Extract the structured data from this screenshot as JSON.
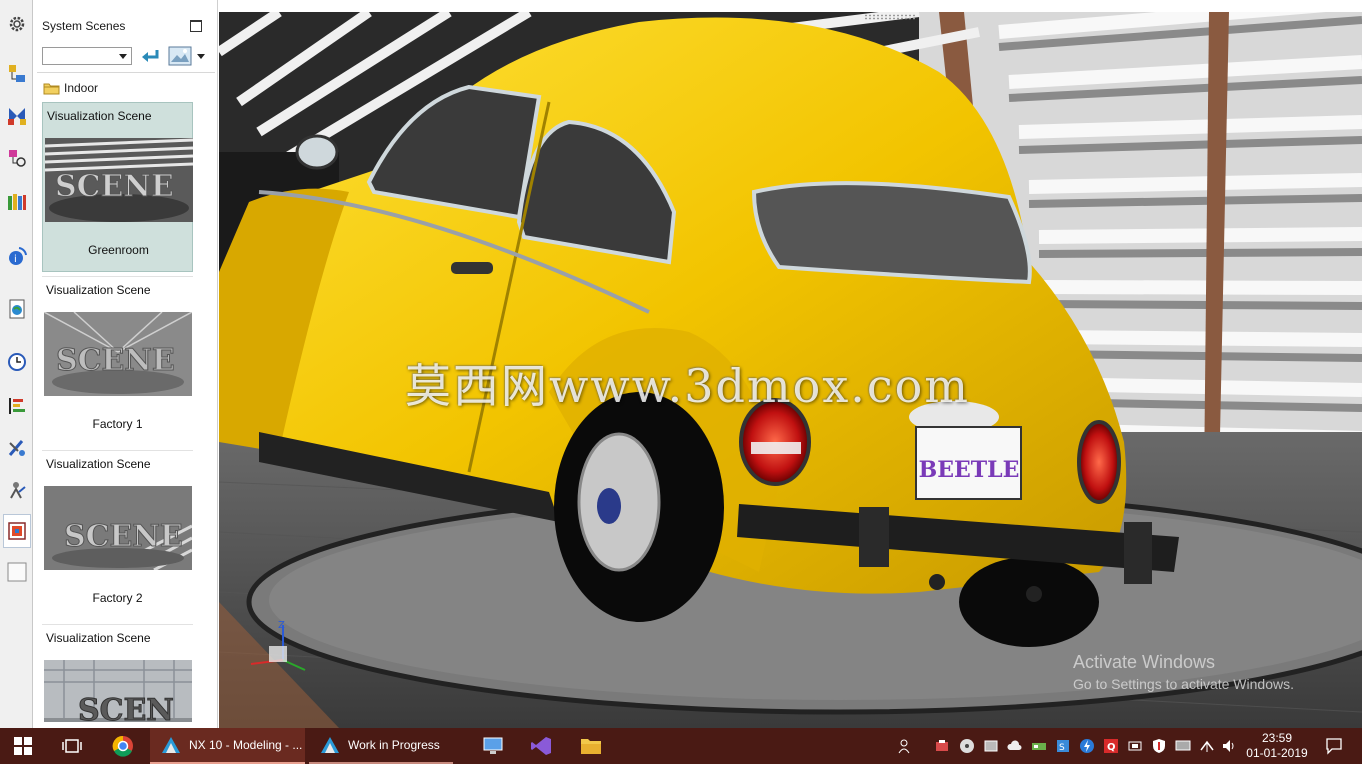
{
  "panel": {
    "title": "System Scenes",
    "combo_value": "",
    "folder": "Indoor",
    "scenes": [
      {
        "type": "Visualization Scene",
        "name": "Greenroom",
        "selected": true
      },
      {
        "type": "Visualization Scene",
        "name": "Factory 1",
        "selected": false
      },
      {
        "type": "Visualization Scene",
        "name": "Factory 2",
        "selected": false
      },
      {
        "type": "Visualization Scene",
        "name": "",
        "selected": false
      }
    ]
  },
  "resource_bar": {
    "icons": [
      "gear-icon",
      "assembly-navigator-icon",
      "constraint-navigator-icon",
      "part-navigator-icon",
      "reuse-library-icon",
      "hd3d-tools-icon",
      "web-browser-icon",
      "history-icon",
      "process-studio-icon",
      "manufacturing-wizards-icon",
      "roles-icon",
      "system-scenes-icon",
      "empty-slot-icon"
    ]
  },
  "viewport": {
    "watermark": "莫西网www.3dmox.com",
    "plate_text": "BEETLE",
    "activation": {
      "line1": "Activate Windows",
      "line2": "Go to Settings to activate Windows."
    },
    "triad_label": "Z"
  },
  "taskbar": {
    "tasks": [
      {
        "label": "NX 10 - Modeling - ...",
        "active": true
      },
      {
        "label": "Work in Progress",
        "active": false
      }
    ],
    "clock": {
      "time": "23:59",
      "date": "01-01-2019"
    }
  },
  "colors": {
    "car_yellow": "#f2c400",
    "taskbar": "#4a1a14",
    "selected_card": "#cfe0dc"
  }
}
